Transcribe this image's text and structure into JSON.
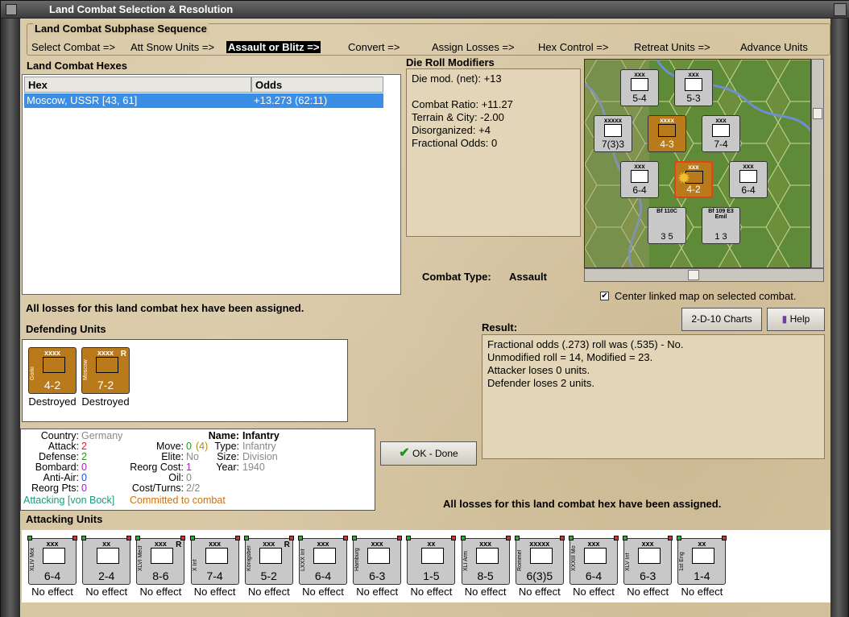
{
  "window": {
    "title": "Land Combat Selection & Resolution"
  },
  "subphase": {
    "title": "Land Combat Subphase Sequence",
    "steps": [
      "Select Combat =>",
      "Att Snow Units =>",
      "Assault or Blitz =>",
      "Convert =>",
      "Assign Losses =>",
      "Hex Control =>",
      "Retreat Units =>",
      "Advance Units"
    ]
  },
  "hexes": {
    "label": "Land Combat Hexes",
    "col_hex": "Hex",
    "col_odds": "Odds",
    "rows": [
      {
        "hex": "Moscow, USSR [43, 61]",
        "odds": "+13.273 (62:11)"
      }
    ]
  },
  "modifiers": {
    "label": "Die Roll Modifiers",
    "lines": [
      "Die mod. (net): +13",
      "",
      "Combat Ratio: +11.27",
      "Terrain & City: -2.00",
      "Disorganized: +4",
      "Fractional Odds: 0"
    ]
  },
  "combat_type": {
    "label": "Combat Type:",
    "value": "Assault"
  },
  "center_map": {
    "label": "Center linked map on selected combat.",
    "checked": true
  },
  "losses_msg": "All losses for this land combat hex have been assigned.",
  "buttons": {
    "charts": "2-D-10 Charts",
    "help": "Help",
    "done": "OK - Done"
  },
  "result": {
    "label": "Result:",
    "lines": [
      "Fractional odds (.273) roll was (.535)  - No.",
      "Unmodified roll = 14, Modified = 23.",
      "Attacker loses 0 units.",
      "Defender loses 2 units."
    ]
  },
  "defenders": {
    "label": "Defending Units",
    "units": [
      {
        "name": "Gorki",
        "size": "xxxx",
        "strength": "4-2",
        "mark": "",
        "status": "Destroyed"
      },
      {
        "name": "Moscow",
        "size": "xxxx",
        "strength": "7-2",
        "mark": "R",
        "status": "Destroyed"
      }
    ]
  },
  "details": {
    "country_label": "Country:",
    "country": "Germany",
    "attack_label": "Attack:",
    "attack": "2",
    "defense_label": "Defense:",
    "defense": "2",
    "bombard_label": "Bombard:",
    "bombard": "0",
    "antiair_label": "Anti-Air:",
    "antiair": "0",
    "reorg_label": "Reorg Pts:",
    "reorg": "0",
    "name_label": "Name:",
    "name": "Infantry",
    "move_label": "Move:",
    "move": "0",
    "move_extra": "(4)",
    "type_label": "Type:",
    "type": "Infantry",
    "elite_label": "Elite:",
    "elite": "No",
    "size_label": "Size:",
    "size": "Division",
    "reorgcost_label": "Reorg Cost:",
    "reorgcost": "1",
    "year_label": "Year:",
    "year": "1940",
    "oil_label": "Oil:",
    "oil": "0",
    "costturns_label": "Cost/Turns:",
    "costturns": "2/2",
    "attacking": "Attacking [von Bock]",
    "committed": "Committed to combat"
  },
  "attackers": {
    "label": "Attacking Units",
    "units": [
      {
        "name": "XLIV Mot",
        "size": "xxx",
        "strength": "6-4",
        "mark": "",
        "status": "No effect"
      },
      {
        "name": "",
        "size": "xx",
        "strength": "2-4",
        "mark": "",
        "status": "No effect"
      },
      {
        "name": "XLVI Mech",
        "size": "xxx",
        "strength": "8-6",
        "mark": "R",
        "status": "No effect"
      },
      {
        "name": "X Inf",
        "size": "xxx",
        "strength": "7-4",
        "mark": "",
        "status": "No effect"
      },
      {
        "name": "Königsberg",
        "size": "xxx",
        "strength": "5-2",
        "mark": "R",
        "status": "No effect"
      },
      {
        "name": "LXXX Inf",
        "size": "xxx",
        "strength": "6-4",
        "mark": "",
        "status": "No effect"
      },
      {
        "name": "Hamburg",
        "size": "xxx",
        "strength": "6-3",
        "mark": "",
        "status": "No effect"
      },
      {
        "name": "",
        "size": "xx",
        "strength": "1-5",
        "mark": "",
        "status": "No effect"
      },
      {
        "name": "XLI Arm",
        "size": "xxx",
        "strength": "8-5",
        "mark": "",
        "status": "No effect"
      },
      {
        "name": "Rommel",
        "size": "xxxxx",
        "strength": "6(3)5",
        "mark": "",
        "status": "No effect"
      },
      {
        "name": "XXXIII Mot",
        "size": "xxx",
        "strength": "6-4",
        "mark": "",
        "status": "No effect"
      },
      {
        "name": "XLV Inf",
        "size": "xxx",
        "strength": "6-3",
        "mark": "",
        "status": "No effect"
      },
      {
        "name": "1st Eng",
        "size": "xx",
        "strength": "1-4",
        "mark": "",
        "status": "No effect"
      }
    ]
  },
  "map": {
    "counters": [
      {
        "name": "Alpine",
        "size": "xxx",
        "strength": "5-4",
        "badge": "3",
        "color": "grey"
      },
      {
        "name": "",
        "size": "xxx",
        "strength": "5-3",
        "badge": "",
        "color": "grey"
      },
      {
        "name": "",
        "size": "xxxxx",
        "strength": "7(3)3",
        "badge": "2",
        "color": "grey"
      },
      {
        "name": "",
        "size": "xxxx",
        "strength": "4-3",
        "badge": "",
        "color": "brown"
      },
      {
        "name": "",
        "size": "xxx",
        "strength": "7-4",
        "badge": "2",
        "color": "grey"
      },
      {
        "name": "",
        "size": "xxx",
        "strength": "6-4",
        "badge": "4",
        "color": "grey"
      },
      {
        "name": "",
        "size": "xxx",
        "strength": "4-2",
        "badge": "2",
        "color": "brown"
      },
      {
        "name": "",
        "size": "xxx",
        "strength": "6-4",
        "badge": "3",
        "color": "grey"
      },
      {
        "name": "Bf 110C",
        "size": "",
        "strength": "3 5",
        "badge": "",
        "color": "grey"
      },
      {
        "name": "Bf 109 E3 Emil",
        "size": "",
        "strength": "1 3",
        "badge": "4",
        "color": "grey"
      }
    ]
  },
  "colors": {
    "parchment": "#d8c7a3",
    "selection": "#3a8ee6",
    "german_grey": "#c8c8c8",
    "soviet_brown": "#b87a1a"
  }
}
